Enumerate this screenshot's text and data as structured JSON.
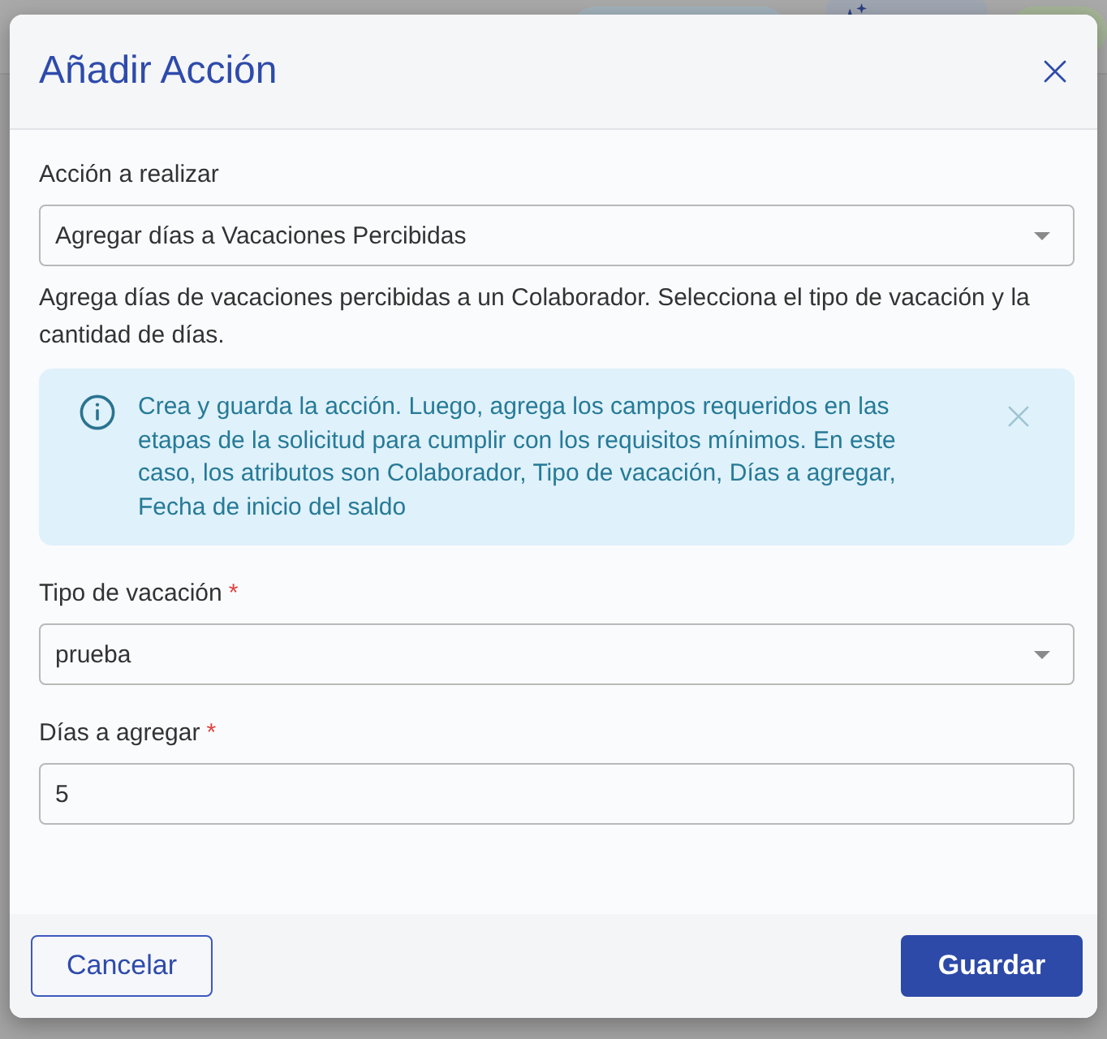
{
  "dialog": {
    "title": "Añadir Acción"
  },
  "body": [
    {
      "kind": "select",
      "label": "Acción a realizar",
      "value": "Agregar días a Vacaciones Percibidas"
    },
    {
      "kind": "paragraph",
      "text": "Agrega días de vacaciones percibidas a un Colaborador. Selecciona el tipo de vacación y la cantidad de días."
    },
    {
      "kind": "alert",
      "text": "Crea y guarda la acción. Luego, agrega los campos requeridos en las etapas de la solicitud para cumplir con los requisitos mínimos. En este caso, los atributos son Colaborador, Tipo de vacación, Días a agregar, Fecha de inicio del saldo"
    },
    {
      "kind": "select",
      "label": "Tipo de vacación",
      "required_mark": "*",
      "value": "prueba"
    },
    {
      "kind": "input",
      "label": "Días a agregar",
      "required_mark": "*",
      "value": "5"
    }
  ],
  "footer": {
    "buttons": [
      {
        "label": "Cancelar",
        "kind": "outline"
      },
      {
        "label": "Guardar",
        "kind": "primary"
      }
    ]
  }
}
